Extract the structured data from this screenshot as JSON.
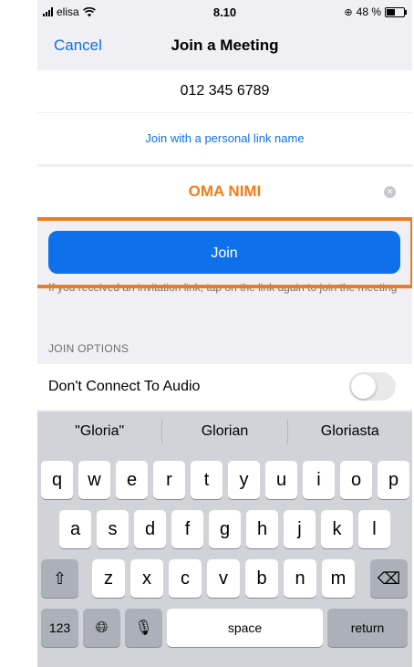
{
  "status_bar": {
    "carrier": "elisa",
    "time": "8.10",
    "battery": "48 %",
    "battery_level": 0.48
  },
  "nav": {
    "cancel_label": "Cancel",
    "title": "Join a Meeting"
  },
  "meeting_id": "012 345 6789",
  "personal_link_label": "Join with a personal link name",
  "name_field": {
    "value": "OMA NIMI"
  },
  "join_button_label": "Join",
  "hint": "If you received an invitation link, tap on the link again to join the meeting",
  "join_options": {
    "section_label": "JOIN OPTIONS",
    "dont_connect_audio": {
      "label": "Don't Connect To Audio",
      "enabled": false
    }
  },
  "keyboard": {
    "suggestions": [
      "\"Gloria\"",
      "Glorian",
      "Gloriasta"
    ],
    "row1": [
      "q",
      "w",
      "e",
      "r",
      "t",
      "y",
      "u",
      "i",
      "o",
      "p"
    ],
    "row2": [
      "a",
      "s",
      "d",
      "f",
      "g",
      "h",
      "j",
      "k",
      "l"
    ],
    "row3": [
      "z",
      "x",
      "c",
      "v",
      "b",
      "n",
      "m"
    ],
    "numbers_label": "123",
    "space_label": "space",
    "return_label": "return"
  },
  "colors": {
    "accent": "#0e71eb",
    "highlight": "#ec7c24",
    "name_text": "#f07d1a"
  },
  "icons": {
    "wifi": "wifi-icon",
    "alarm": "alarm-icon",
    "clear": "clear-icon",
    "shift": "shift-icon",
    "delete": "delete-icon",
    "globe": "globe-icon",
    "mic": "microphone-icon"
  }
}
